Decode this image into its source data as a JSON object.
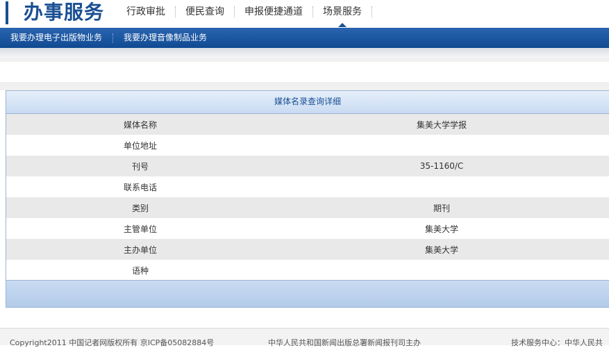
{
  "header": {
    "brand": "办事服务",
    "nav": [
      {
        "label": "行政审批"
      },
      {
        "label": "便民查询"
      },
      {
        "label": "申报便捷通道"
      },
      {
        "label": "场景服务"
      }
    ]
  },
  "subnav": {
    "items": [
      {
        "label": "我要办理电子出版物业务"
      },
      {
        "label": "我要办理音像制品业务"
      }
    ]
  },
  "detail": {
    "title": "媒体名录查询详细",
    "rows": [
      {
        "label": "媒体名称",
        "value": "集美大学学报"
      },
      {
        "label": "单位地址",
        "value": ""
      },
      {
        "label": "刊号",
        "value": "35-1160/C"
      },
      {
        "label": "联系电话",
        "value": ""
      },
      {
        "label": "类别",
        "value": "期刊"
      },
      {
        "label": "主管单位",
        "value": "集美大学"
      },
      {
        "label": "主办单位",
        "value": "集美大学"
      },
      {
        "label": "语种",
        "value": ""
      }
    ]
  },
  "footer": {
    "copyright": "Copyright2011   中国记者网版权所有   京ICP备05082884号",
    "sponsor": "中华人民共和国新闻出版总署新闻报刊司主办",
    "support": "技术服务中心：中华人民共"
  }
}
